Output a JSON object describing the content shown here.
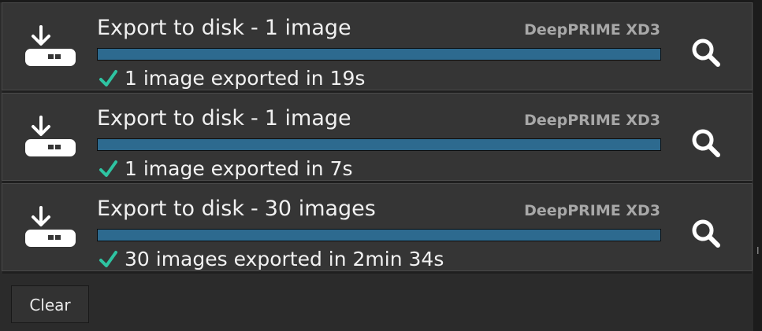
{
  "jobs": [
    {
      "action": "Export to disk",
      "count": "1 image",
      "process": "DeepPRIME XD3",
      "progress": 1.0,
      "status": "1 image exported in 19s"
    },
    {
      "action": "Export to disk",
      "count": "1 image",
      "process": "DeepPRIME XD3",
      "progress": 1.0,
      "status": "1 image exported in 7s"
    },
    {
      "action": "Export to disk",
      "count": "30 images",
      "process": "DeepPRIME XD3",
      "progress": 1.0,
      "status": "30 images exported in 2min 34s"
    }
  ],
  "separator": "-",
  "icons": {
    "export": "export-to-disk-icon",
    "done": "checkmark-icon",
    "reveal": "magnifier-icon"
  },
  "colors": {
    "progress": "#2d6a8f",
    "check": "#2ec4a2",
    "process_text": "#a8a8a8"
  },
  "footer": {
    "clear_label": "Clear"
  }
}
